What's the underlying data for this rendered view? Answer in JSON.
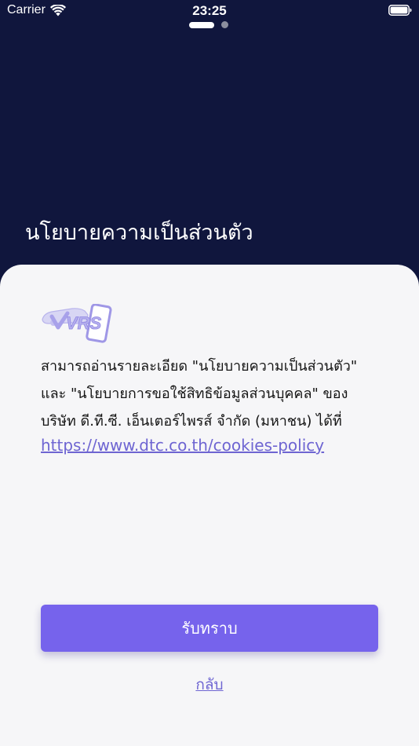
{
  "status_bar": {
    "carrier": "Carrier",
    "time": "23:25",
    "icons": [
      "wifi-icon",
      "battery-icon"
    ]
  },
  "pager": {
    "pages": 2,
    "active_index": 0
  },
  "header": {
    "title": "นโยบายความเป็นส่วนตัว"
  },
  "content": {
    "logo_text": "VRS",
    "paragraph_lines": [
      "สามารถอ่านรายละเอียด \"นโยบายความเป็นส่วนตัว\"",
      "และ \"นโยบายการขอใช้สิทธิข้อมูลส่วนบุคคล\" ของ",
      "บริษัท ดี.ที.ซี. เอ็นเตอร์ไพรส์ จำกัด (มหาชน)  ได้ที่"
    ],
    "link": "https://www.dtc.co.th/cookies-policy"
  },
  "actions": {
    "accept_label": "รับทราบ",
    "back_label": "กลับ"
  },
  "colors": {
    "header_background": "#10163d",
    "sheet_background": "#f6f6f8",
    "accent": "#7663ec",
    "link": "#6e65d2"
  }
}
